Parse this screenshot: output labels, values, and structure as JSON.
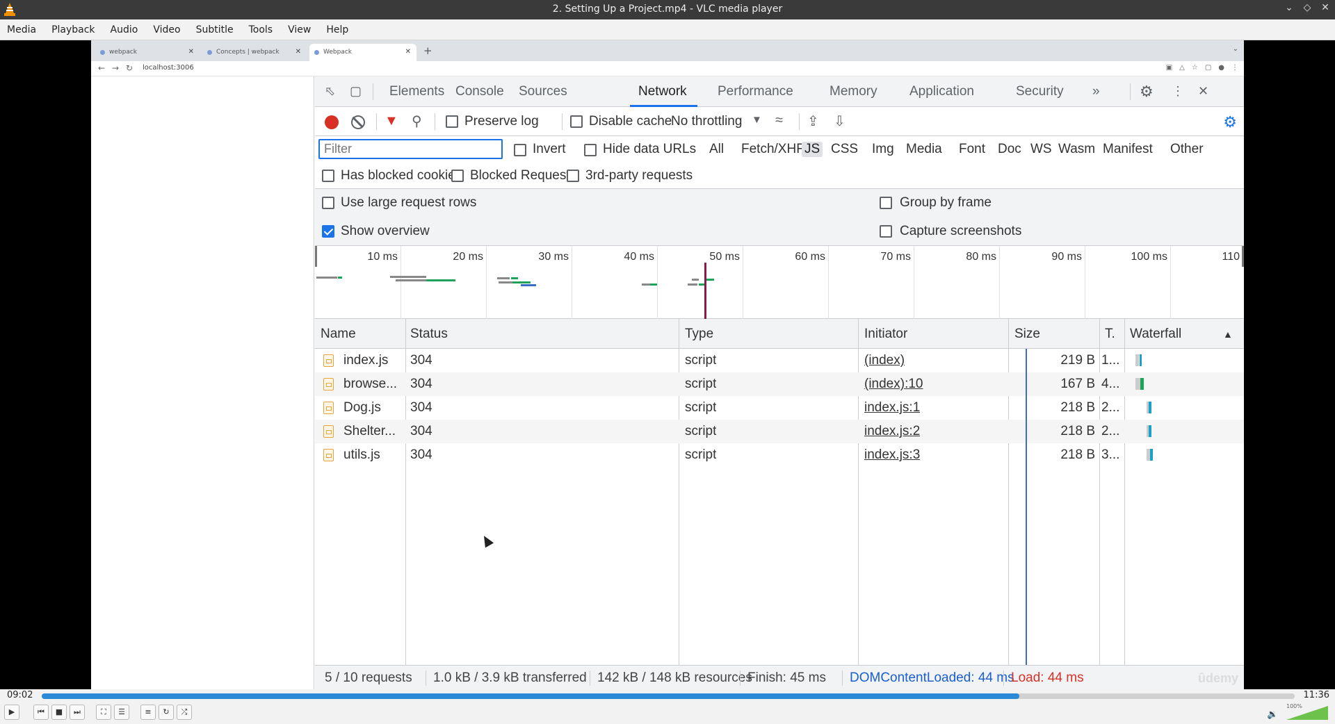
{
  "window": {
    "title": "2. Setting Up a Project.mp4 - VLC media player"
  },
  "menu": [
    "Media",
    "Playback",
    "Audio",
    "Video",
    "Subtitle",
    "Tools",
    "View",
    "Help"
  ],
  "browser": {
    "tabs": [
      "webpack",
      "Concepts | webpack",
      "Webpack"
    ],
    "url": "localhost:3006"
  },
  "devtools": {
    "tabs": [
      "Elements",
      "Console",
      "Sources",
      "Network",
      "Performance",
      "Memory",
      "Application",
      "Security"
    ],
    "more": "»",
    "preserve_log": "Preserve log",
    "disable_cache": "Disable cache",
    "throttling": "No throttling",
    "filter_placeholder": "Filter",
    "invert": "Invert",
    "hide_data_urls": "Hide data URLs",
    "types": [
      "All",
      "Fetch/XHR",
      "JS",
      "CSS",
      "Img",
      "Media",
      "Font",
      "Doc",
      "WS",
      "Wasm",
      "Manifest",
      "Other"
    ],
    "selected_type": "JS",
    "has_blocked_cookies": "Has blocked cookies",
    "blocked_requests": "Blocked Requests",
    "third_party": "3rd-party requests",
    "use_large_rows": "Use large request rows",
    "group_by_frame": "Group by frame",
    "show_overview": "Show overview",
    "capture_screenshots": "Capture screenshots",
    "overview_ticks": [
      "10 ms",
      "20 ms",
      "30 ms",
      "40 ms",
      "50 ms",
      "60 ms",
      "70 ms",
      "80 ms",
      "90 ms",
      "100 ms",
      "110"
    ],
    "columns": {
      "name": "Name",
      "status": "Status",
      "type": "Type",
      "initiator": "Initiator",
      "size": "Size",
      "time": "T.",
      "waterfall": "Waterfall",
      "sort_arrow": "▲"
    },
    "rows": [
      {
        "name": "index.js",
        "status": "304",
        "type": "script",
        "initiator": "(index)",
        "size": "219 B",
        "time": "1..."
      },
      {
        "name": "browse...",
        "status": "304",
        "type": "script",
        "initiator": "(index):10",
        "size": "167 B",
        "time": "4..."
      },
      {
        "name": "Dog.js",
        "status": "304",
        "type": "script",
        "initiator": "index.js:1",
        "size": "218 B",
        "time": "2..."
      },
      {
        "name": "Shelter...",
        "status": "304",
        "type": "script",
        "initiator": "index.js:2",
        "size": "218 B",
        "time": "2..."
      },
      {
        "name": "utils.js",
        "status": "304",
        "type": "script",
        "initiator": "index.js:3",
        "size": "218 B",
        "time": "3..."
      }
    ],
    "status": {
      "requests": "5 / 10 requests",
      "transferred": "1.0 kB / 3.9 kB transferred",
      "resources": "142 kB / 148 kB resources",
      "finish": "Finish: 45 ms",
      "dcl": "DOMContentLoaded: 44 ms",
      "load": "Load: 44 ms"
    },
    "watermark": "ûdemy"
  },
  "player": {
    "elapsed": "09:02",
    "total": "11:36",
    "progress": 0.78,
    "volume_pct": "100%"
  },
  "colors": {
    "accent": "#1a73e8",
    "record": "#d93025",
    "seek": "#2a8ad8",
    "volume": "#6cc24a"
  }
}
